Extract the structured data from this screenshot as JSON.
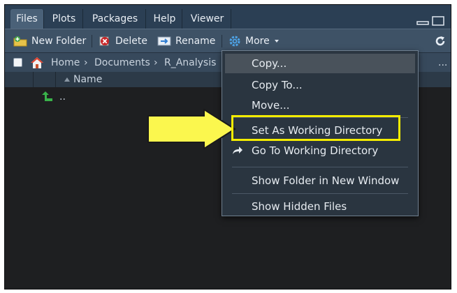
{
  "tabs": [
    {
      "label": "Files",
      "active": true
    },
    {
      "label": "Plots"
    },
    {
      "label": "Packages"
    },
    {
      "label": "Help"
    },
    {
      "label": "Viewer"
    }
  ],
  "toolbar": {
    "new_folder": "New Folder",
    "delete": "Delete",
    "rename": "Rename",
    "more": "More"
  },
  "breadcrumb": {
    "home": "Home",
    "documents": "Documents",
    "folder": "R_Analysis",
    "overflow": "..."
  },
  "file_list": {
    "name_header": "Name",
    "parent_dir": ".."
  },
  "more_menu": {
    "items": [
      "Copy...",
      "Copy To...",
      "Move...",
      "Set As Working Directory",
      "Go To Working Directory",
      "Show Folder in New Window",
      "Show Hidden Files"
    ],
    "highlighted": "Set As Working Directory"
  },
  "colors": {
    "highlight": "#f4ec00",
    "arrow": "#fbf74e",
    "tab_bar": "#2b3f54",
    "toolbar": "#3e5266"
  },
  "icons": [
    "new-folder-icon",
    "delete-icon",
    "rename-icon",
    "gear-icon",
    "home-icon",
    "up-arrow-icon",
    "refresh-icon",
    "go-to-arrow-icon"
  ]
}
